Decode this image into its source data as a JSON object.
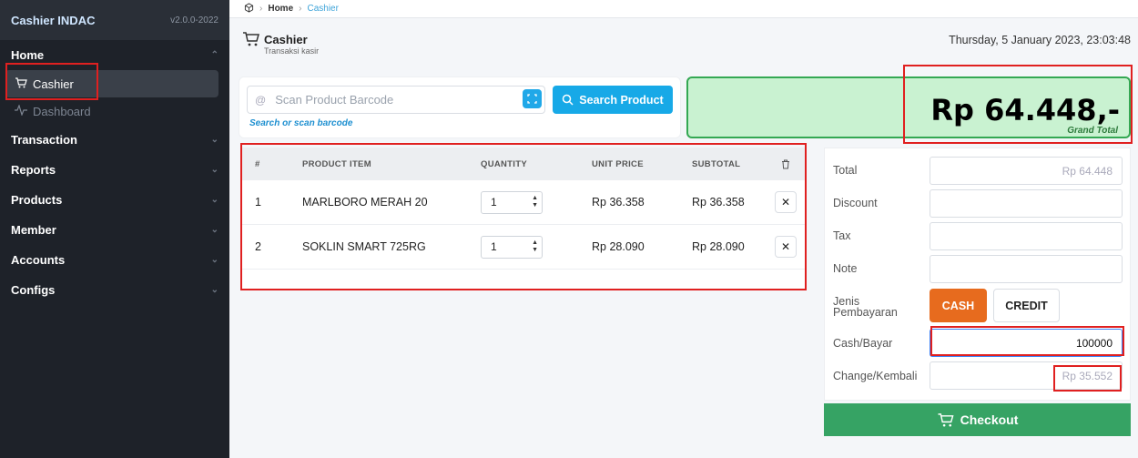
{
  "sidebar": {
    "brand": "Cashier INDAC",
    "version": "v2.0.0-2022",
    "home": "Home",
    "items": [
      {
        "label": "Cashier",
        "icon": "cart-icon",
        "active": true
      },
      {
        "label": "Dashboard",
        "icon": "pulse-icon",
        "active": false
      }
    ],
    "sections": [
      "Transaction",
      "Reports",
      "Products",
      "Member",
      "Accounts",
      "Configs"
    ]
  },
  "breadcrumb": {
    "home": "Home",
    "current": "Cashier"
  },
  "header": {
    "title": "Cashier",
    "subtitle": "Transaksi kasir",
    "datetime": "Thursday, 5 January 2023, 23:03:48"
  },
  "search": {
    "placeholder": "Scan Product Barcode",
    "button": "Search Product",
    "hint": "Search or scan barcode"
  },
  "grand_total": {
    "amount": "Rp 64.448,-",
    "label": "Grand Total"
  },
  "table": {
    "headers": [
      "#",
      "PRODUCT ITEM",
      "QUANTITY",
      "UNIT PRICE",
      "SUBTOTAL"
    ],
    "rows": [
      {
        "no": "1",
        "item": "MARLBORO MERAH 20",
        "qty": "1",
        "price": "Rp 36.358",
        "subtotal": "Rp 36.358"
      },
      {
        "no": "2",
        "item": "SOKLIN SMART 725RG",
        "qty": "1",
        "price": "Rp 28.090",
        "subtotal": "Rp 28.090"
      }
    ]
  },
  "payment": {
    "total_label": "Total",
    "total_value": "Rp 64.448",
    "discount_label": "Discount",
    "tax_label": "Tax",
    "note_label": "Note",
    "method_label_1": "Jenis",
    "method_label_2": "Pembayaran",
    "cash": "CASH",
    "credit": "CREDIT",
    "cash_label": "Cash/Bayar",
    "cash_value": "100000",
    "change_label": "Change/Kembali",
    "change_value": "Rp 35.552",
    "checkout": "Checkout"
  },
  "colors": {
    "accent": "#17a9e7",
    "success": "#36a364",
    "cash": "#e76b1e",
    "annotation": "#e02020"
  }
}
